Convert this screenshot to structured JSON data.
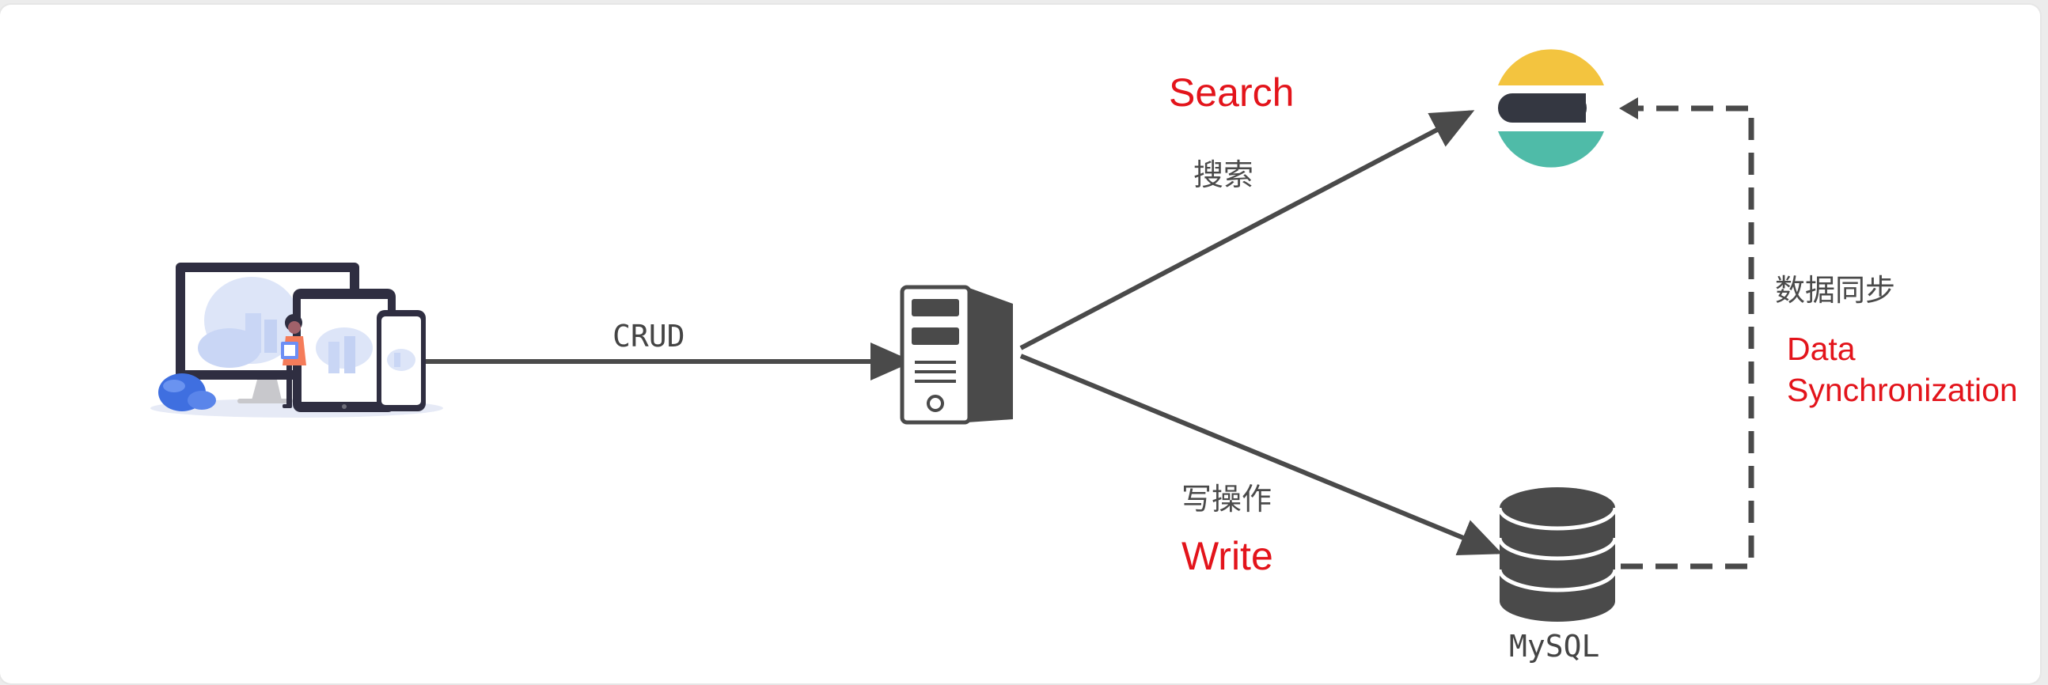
{
  "labels": {
    "crud": "CRUD",
    "search_en": "Search",
    "search_zh": "搜索",
    "write_zh": "写操作",
    "write_en": "Write",
    "sync_zh": "数据同步",
    "sync_en_1": "Data",
    "sync_en_2": "Synchronization",
    "db_name": "MySQL"
  },
  "icons": {
    "client": "devices-illustration-icon",
    "server": "server-tower-icon",
    "search_engine": "elasticsearch-logo-icon",
    "database": "database-cylinder-icon"
  },
  "colors": {
    "arrow": "#4a4a4a",
    "accent_text": "#e3141b",
    "es_yellow": "#f3c43f",
    "es_dark": "#343741",
    "es_teal": "#4fbba8"
  }
}
